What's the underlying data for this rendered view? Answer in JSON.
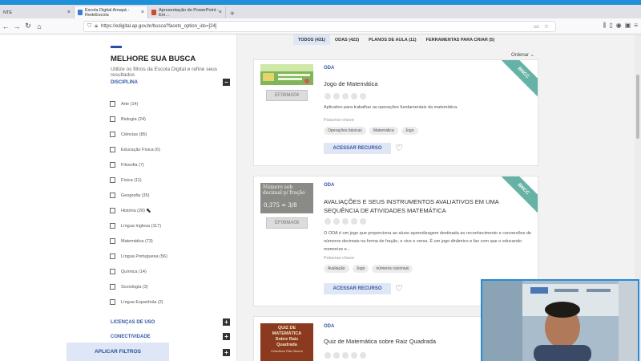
{
  "browser": {
    "tabs": [
      {
        "label": "NTE",
        "active": false
      },
      {
        "label": "Escola Digital Amapá - RedeEscola",
        "active": true
      },
      {
        "label": "Apresentação do PowerPoint - Em…",
        "active": false
      }
    ],
    "new_tab": "+",
    "url": "https://edigital.ap.gov.br/busca?facets_option_ids=[24]"
  },
  "sidebar": {
    "title": "MELHORE SUA BUSCA",
    "subtitle": "Utilize os filtros da Escola Digital e refine seus resultados",
    "discipline_header": "DISCIPLINA",
    "disciplines": [
      {
        "label": "Arte (14)"
      },
      {
        "label": "Biologia (24)"
      },
      {
        "label": "Ciências (85)"
      },
      {
        "label": "Educação Física (6)"
      },
      {
        "label": "Filosofia (7)"
      },
      {
        "label": "Física (11)"
      },
      {
        "label": "Geografia (35)"
      },
      {
        "label": "História (28)"
      },
      {
        "label": "Língua Inglesa (117)"
      },
      {
        "label": "Matemática (73)"
      },
      {
        "label": "Língua Portuguesa (56)"
      },
      {
        "label": "Química (14)"
      },
      {
        "label": "Sociologia (3)"
      },
      {
        "label": "Língua Espanhola (2)"
      }
    ],
    "licenses_header": "LICENÇAS DE USO",
    "connectivity_header": "CONECTIVIDADE",
    "apply_button": "APLICAR FILTROS"
  },
  "results": {
    "tabs": [
      {
        "label": "TODOS (431)",
        "active": true
      },
      {
        "label": "ODAS (422)",
        "active": false
      },
      {
        "label": "PLANOS DE AULA (11)",
        "active": false
      },
      {
        "label": "FERRAMENTAS PARA CRIAR (5)",
        "active": false
      }
    ],
    "order_label": "Ordenar ⌄",
    "keywords_label": "Palavras-chave",
    "access_label": "ACESSAR RECURSO",
    "cards": [
      {
        "type": "ODA",
        "badge": "BNCC",
        "code": "EF06MA04",
        "title": "Jogo de Matemática",
        "description": "Aplicativo para trabalhar as operações fundamentais da matemática.",
        "keywords": [
          "Operações básicas",
          "Matemática",
          "Jogo"
        ]
      },
      {
        "type": "ODA",
        "badge": "BNCC",
        "code": "EF06MA08",
        "title": "AVALIAÇÕES E SEUS INSTRUMENTOS AVALIATIVOS EM UMA SEQUÊNCIA DE ATIVIDADES MATEMÁTICA",
        "description": "O ODA é um jogo que proporciona ao aluno aprendizagem destinada ao reconhecimento e conversões de números decimais na forma de fração, e vice e versa. É um jogo dinâmico e faz com que o educando memorize e...",
        "keywords": [
          "Avaliação",
          "Jogo",
          "números racionais"
        ],
        "thumb_text": "Número sob decimal p/ fração",
        "thumb_formula": "0,375 = 3/8"
      },
      {
        "type": "ODA",
        "title": "Quiz de Matemática sobre Raiz Quadrada",
        "thumb_lines": [
          "QUIZ DE",
          "MATEMÁTICA",
          "Sobre Raiz",
          "Quadrada",
          "Cristofson Raiz Bueno"
        ]
      }
    ]
  },
  "colors": {
    "accent": "#2b4fa0",
    "badge": "#66b2a6",
    "button_bg": "#dfe6f5"
  }
}
